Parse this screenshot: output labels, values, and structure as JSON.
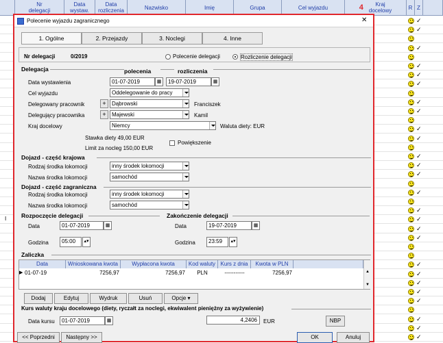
{
  "grid": {
    "columns": [
      "Nr\ndelegacji",
      "Data\nwystaw.",
      "Data\nrozliczenia",
      "Nazwisko",
      "Imię",
      "Grupa",
      "Cel wyjazdu",
      "Kraj\ndocelowy",
      "R",
      "Z"
    ],
    "badge": "4",
    "row_marker": "I"
  },
  "dialog": {
    "title": "Polecenie wyjazdu zagranicznego",
    "close": "✕",
    "tabs": [
      "1. Ogólne",
      "2. Przejazdy",
      "3. Noclegi",
      "4. Inne"
    ],
    "nr_label": "Nr delegacji",
    "nr_value": "0/2019",
    "radio_polecenie": "Polecenie delegacji",
    "radio_rozliczenie": "Rozliczenie delegacji"
  },
  "delegacja": {
    "section": "Delegacja",
    "col_polecenia": "polecenia",
    "col_rozliczenia": "rozliczenia",
    "data_wystawienia_label": "Data wystawienia",
    "data_polecenia": "01-07-2019",
    "data_rozliczenia": "19-07-2019",
    "cel_label": "Cel wyjazdu",
    "cel_value": "Oddelegowanie do pracy",
    "delegowany_label": "Delegowany pracownik",
    "delegowany_value": "Dąbrowski",
    "delegowany_imie": "Franciszek",
    "delegujacy_label": "Delegujący pracownika",
    "delegujacy_value": "Majewski",
    "delegujacy_imie": "Kamil",
    "kraj_label": "Kraj docelowy",
    "kraj_value": "Niemcy",
    "waluta": "Waluta diety: EUR",
    "stawka": "Stawka diety 49,00 EUR",
    "limit": "Limit za nocleg 150,00 EUR",
    "powiekszenie": "Powiększenie"
  },
  "dojazd_krajowy": {
    "section": "Dojazd - część krajowa",
    "rodzaj_label": "Rodzaj środka lokomocji",
    "rodzaj_value": "inny środek lokomocji",
    "nazwa_label": "Nazwa środka lokomocji",
    "nazwa_value": "samochód"
  },
  "dojazd_zagraniczny": {
    "section": "Dojazd - część zagraniczna",
    "rodzaj_label": "Rodzaj środka lokomocji",
    "rodzaj_value": "inny środek lokomocji",
    "nazwa_label": "Nazwa środka lokomocji",
    "nazwa_value": "samochód"
  },
  "rozpoczecie": {
    "section": "Rozpoczęcie delegacji",
    "data_label": "Data",
    "data_value": "01-07-2019",
    "godzina_label": "Godzina",
    "godzina_value": "05:00"
  },
  "zakonczenie": {
    "section": "Zakończenie delegacji",
    "data_label": "Data",
    "data_value": "19-07-2019",
    "godzina_label": "Godzina",
    "godzina_value": "23:59"
  },
  "zaliczka": {
    "section": "Zaliczka",
    "headers": [
      "Data",
      "Wnioskowana kwota",
      "Wypłacona kwota",
      "Kod waluty",
      "Kurs z dnia",
      "Kwota w PLN"
    ],
    "row": [
      "01-07-19",
      "7256,97",
      "7256,97",
      "PLN",
      "-----------",
      "7256,97"
    ],
    "buttons": [
      "Dodaj",
      "Edytuj",
      "Wydruk",
      "Usuń",
      "Opcje ▾"
    ]
  },
  "kurs": {
    "section": "Kurs waluty kraju docelowego (diety, ryczałt za noclegi, ekwiwalent pieniężny za wyżywienie)",
    "data_label": "Data kursu",
    "data_value": "01-07-2019",
    "kurs_value": "4,2406",
    "waluta": "EUR",
    "nbp": "NBP"
  },
  "footer": {
    "prev": "<< Poprzedni",
    "next": "Następny >>",
    "ok": "OK",
    "cancel": "Anuluj"
  },
  "colors": {
    "accent_red": "#e0262c",
    "header_blue": "#1f3da8",
    "header_bg": "#d9e2f2"
  }
}
